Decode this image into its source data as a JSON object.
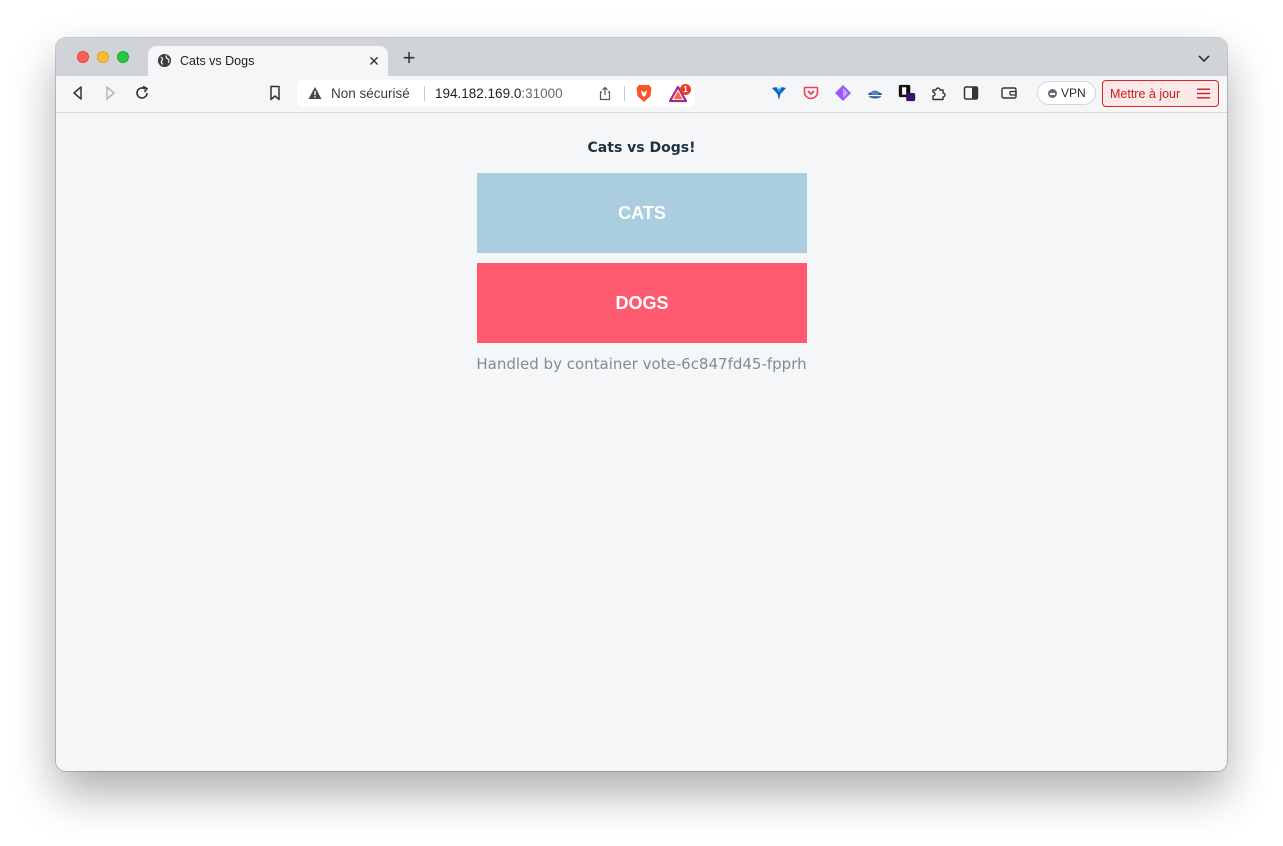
{
  "browser": {
    "tab": {
      "title": "Cats vs Dogs",
      "favicon": "globe-icon"
    },
    "urlbar": {
      "security_label": "Non sécurisé",
      "host": "194.182.169.0",
      "port": ":31000",
      "rewards_badge": "1"
    },
    "extensions": [
      "lumen-icon",
      "pocket-icon",
      "diamond-extension-icon",
      "cloud-extension-icon",
      "notion-extension-icon",
      "puzzle-icon",
      "sidebar-icon",
      "wallet-icon"
    ],
    "vpn_label": "VPN",
    "update_label": "Mettre à jour"
  },
  "page": {
    "title": "Cats vs Dogs!",
    "option_a": "CATS",
    "option_b": "DOGS",
    "footer": "Handled by container vote-6c847fd45-fpprh",
    "colors": {
      "cats": "#abcde0",
      "dogs": "#ff5a70",
      "background": "#f5f6f8",
      "title": "#1d3140"
    }
  }
}
